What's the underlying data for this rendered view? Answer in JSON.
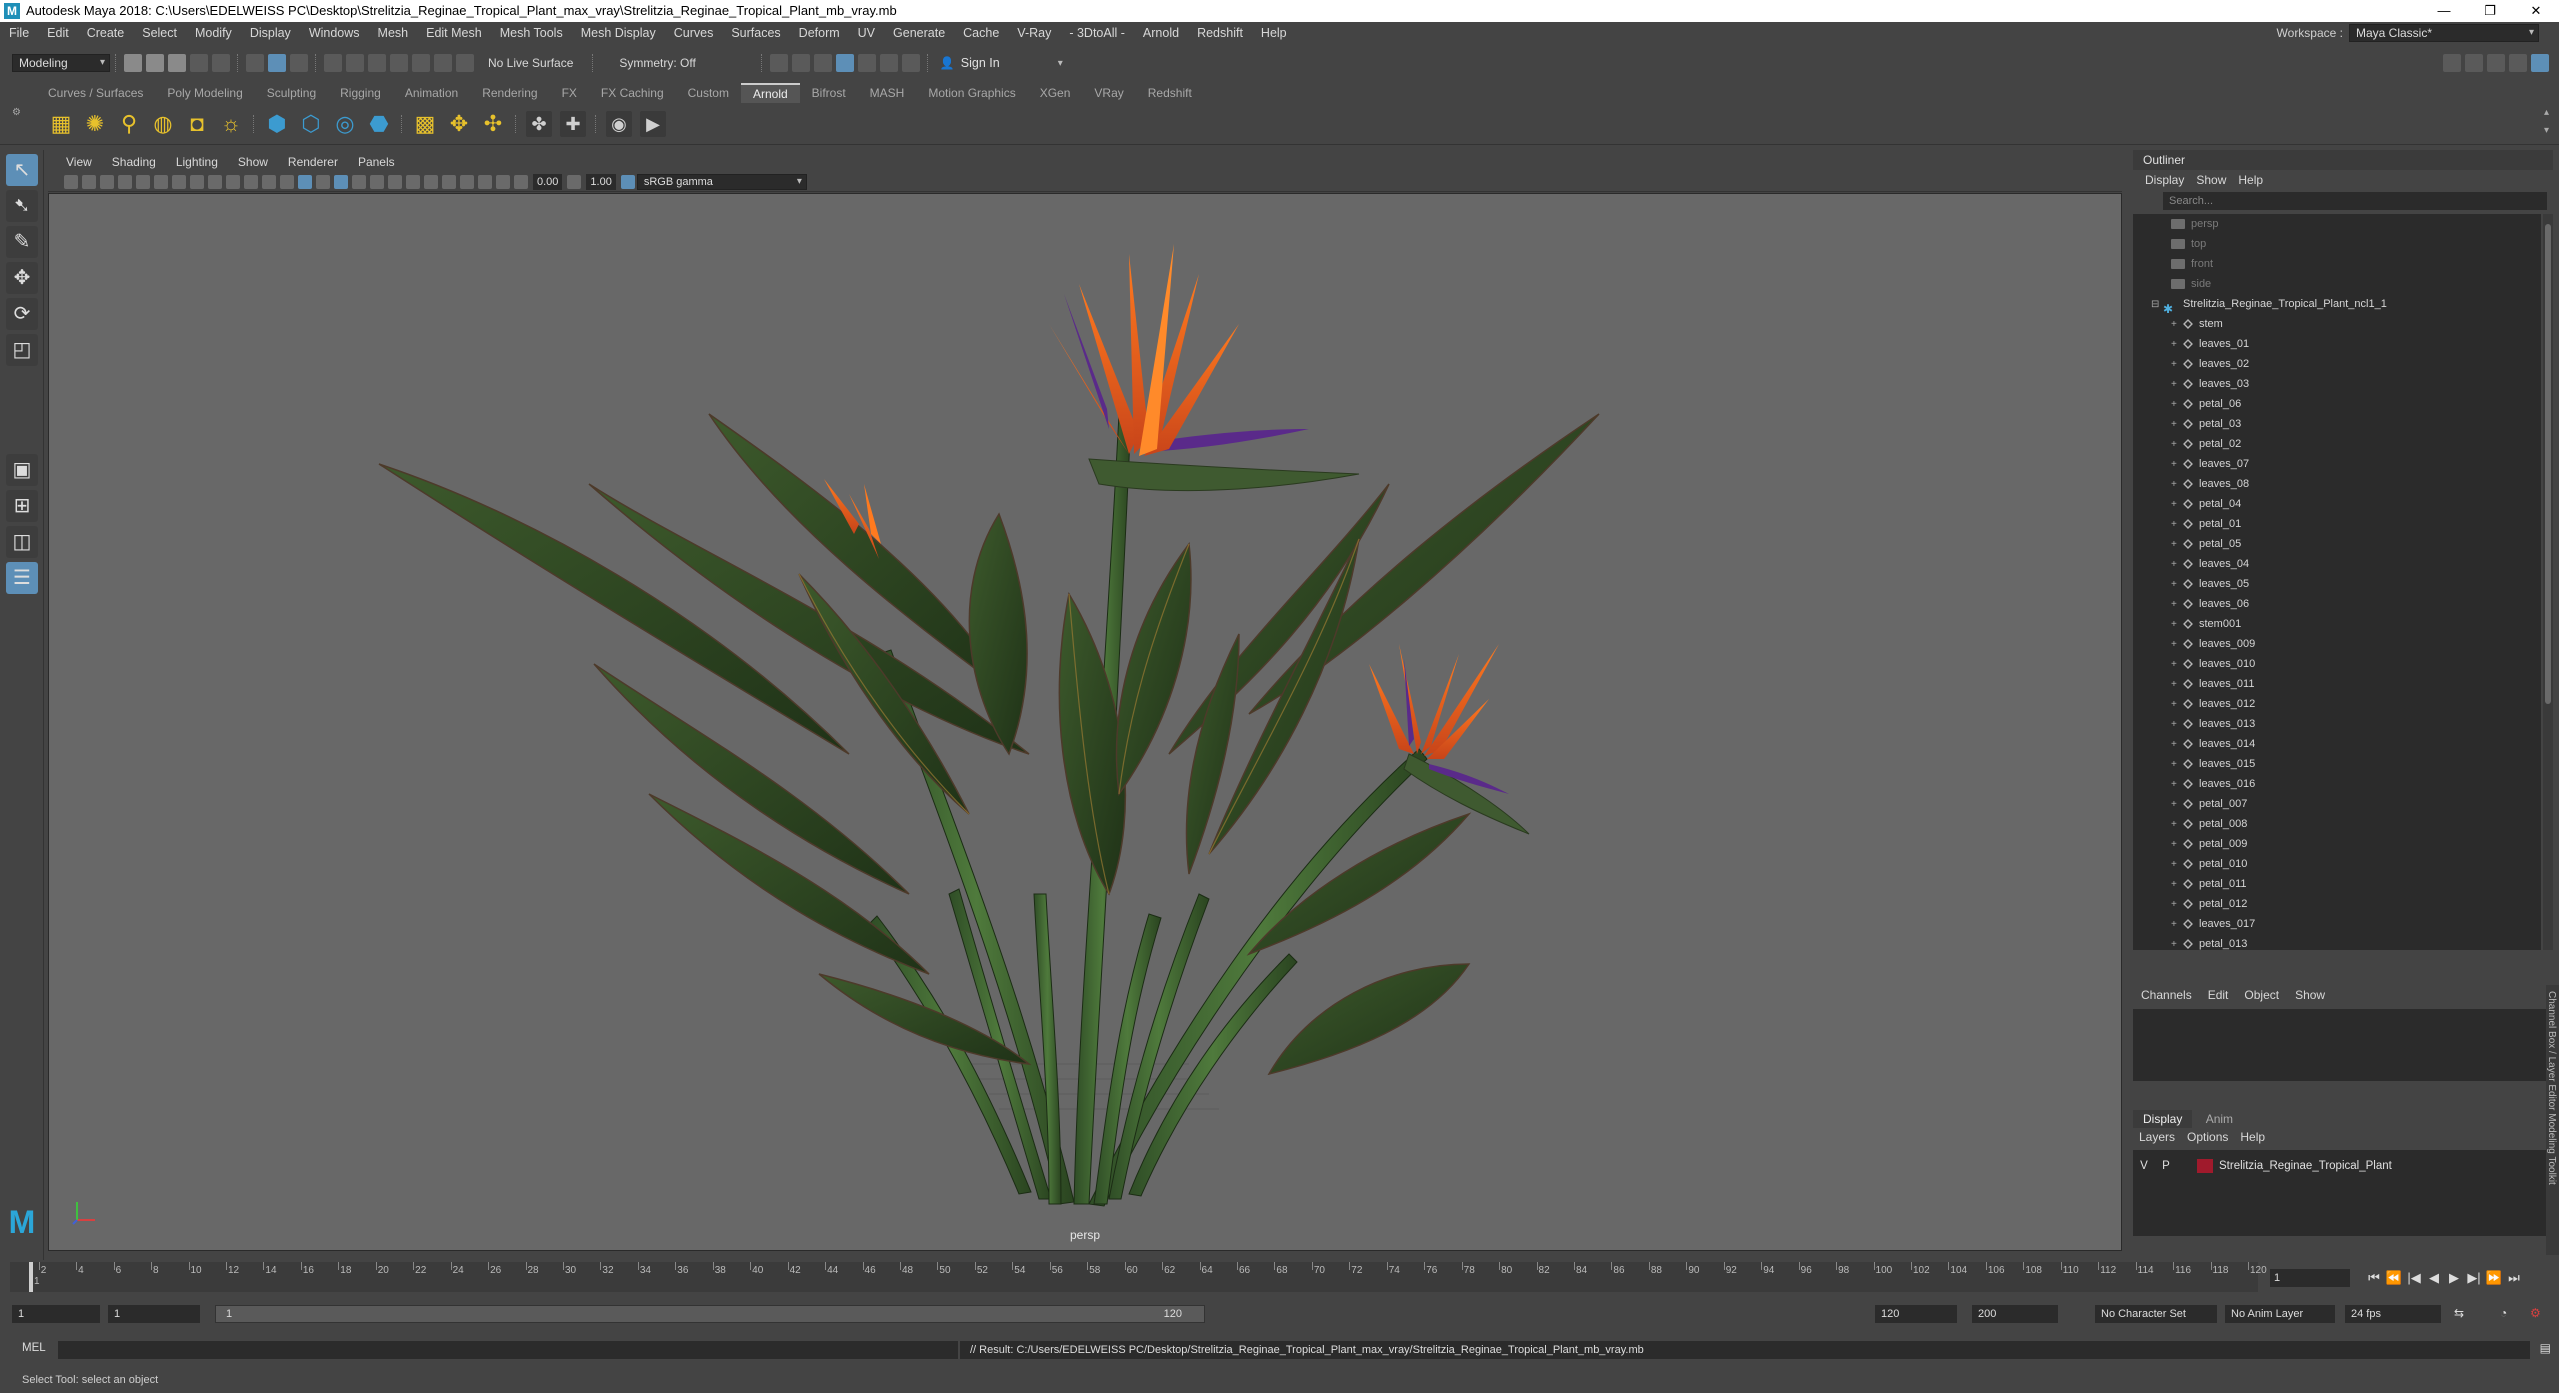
{
  "window": {
    "title": "Autodesk Maya 2018: C:\\Users\\EDELWEISS PC\\Desktop\\Strelitzia_Reginae_Tropical_Plant_max_vray\\Strelitzia_Reginae_Tropical_Plant_mb_vray.mb",
    "minimize": "—",
    "maximize": "❐",
    "close": "✕"
  },
  "menubar": {
    "items": [
      "File",
      "Edit",
      "Create",
      "Select",
      "Modify",
      "Display",
      "Windows",
      "Mesh",
      "Edit Mesh",
      "Mesh Tools",
      "Mesh Display",
      "Curves",
      "Surfaces",
      "Deform",
      "UV",
      "Generate",
      "Cache",
      "V-Ray",
      "- 3DtoAll -",
      "Arnold",
      "Redshift",
      "Help"
    ],
    "workspace_label": "Workspace :",
    "workspace_value": "Maya Classic*"
  },
  "statusline": {
    "mode": "Modeling",
    "live_surface": "No Live Surface",
    "symmetry": "Symmetry: Off",
    "sign_in": "Sign In"
  },
  "shelf": {
    "tabs": [
      "Curves / Surfaces",
      "Poly Modeling",
      "Sculpting",
      "Rigging",
      "Animation",
      "Rendering",
      "FX",
      "FX Caching",
      "Custom",
      "Arnold",
      "Bifrost",
      "MASH",
      "Motion Graphics",
      "XGen",
      "VRay",
      "Redshift"
    ],
    "active_tab": "Arnold"
  },
  "viewport": {
    "menu": [
      "View",
      "Shading",
      "Lighting",
      "Show",
      "Renderer",
      "Panels"
    ],
    "exposure": "0.00",
    "gamma": "1.00",
    "color_space": "sRGB gamma",
    "camera_label": "persp"
  },
  "outliner": {
    "title": "Outliner",
    "menu": [
      "Display",
      "Show",
      "Help"
    ],
    "search_placeholder": "Search...",
    "cameras": [
      "persp",
      "top",
      "front",
      "side"
    ],
    "root": "Strelitzia_Reginae_Tropical_Plant_ncl1_1",
    "children": [
      "stem",
      "leaves_01",
      "leaves_02",
      "leaves_03",
      "petal_06",
      "petal_03",
      "petal_02",
      "leaves_07",
      "leaves_08",
      "petal_04",
      "petal_01",
      "petal_05",
      "leaves_04",
      "leaves_05",
      "leaves_06",
      "stem001",
      "leaves_009",
      "leaves_010",
      "leaves_011",
      "leaves_012",
      "leaves_013",
      "leaves_014",
      "leaves_015",
      "leaves_016",
      "petal_007",
      "petal_008",
      "petal_009",
      "petal_010",
      "petal_011",
      "petal_012",
      "leaves_017",
      "petal_013"
    ]
  },
  "channelbox": {
    "menu": [
      "Channels",
      "Edit",
      "Object",
      "Show"
    ]
  },
  "layereditor": {
    "tabs": [
      "Display",
      "Anim"
    ],
    "menu": [
      "Layers",
      "Options",
      "Help"
    ],
    "layer": {
      "v": "V",
      "p": "P",
      "name": "Strelitzia_Reginae_Tropical_Plant",
      "color": "#a01a2c"
    }
  },
  "side_tab": "Channel Box / Layer Editor   Modeling Toolkit",
  "timeline": {
    "ticks": [
      "2",
      "4",
      "6",
      "8",
      "10",
      "12",
      "14",
      "16",
      "18",
      "20",
      "22",
      "24",
      "26",
      "28",
      "30",
      "32",
      "34",
      "36",
      "38",
      "40",
      "42",
      "44",
      "46",
      "48",
      "50",
      "52",
      "54",
      "56",
      "58",
      "60",
      "62",
      "64",
      "66",
      "68",
      "70",
      "72",
      "74",
      "76",
      "78",
      "80",
      "82",
      "84",
      "86",
      "88",
      "90",
      "92",
      "94",
      "96",
      "98",
      "100",
      "102",
      "104",
      "106",
      "108",
      "110",
      "112",
      "114",
      "116",
      "118",
      "120"
    ],
    "current_frame_label": "1",
    "current_frame_field": "1"
  },
  "range": {
    "start": "1",
    "playback_start": "1",
    "range_start_label": "1",
    "range_end_label": "120",
    "playback_end": "120",
    "end": "200",
    "character_set": "No Character Set",
    "anim_layer": "No Anim Layer",
    "fps": "24 fps"
  },
  "commandline": {
    "lang": "MEL",
    "result": "// Result: C:/Users/EDELWEISS PC/Desktop/Strelitzia_Reginae_Tropical_Plant_max_vray/Strelitzia_Reginae_Tropical_Plant_mb_vray.mb"
  },
  "helpline": "Select Tool: select an object",
  "brand": "M",
  "axis": {
    "x": "",
    "y": ""
  }
}
